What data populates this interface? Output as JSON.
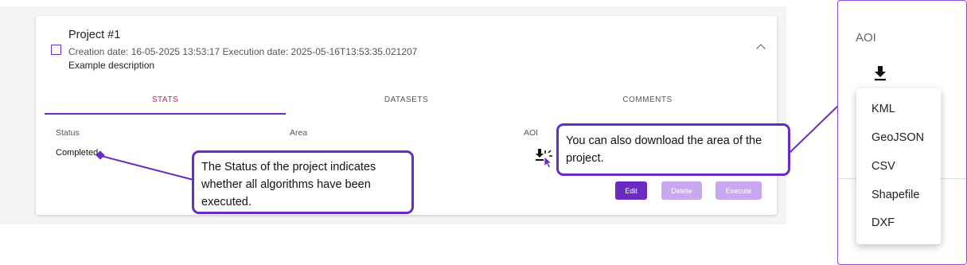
{
  "project": {
    "title": "Project #1",
    "dates": "Creation date: 16-05-2025 13:53:17 Execution date: 2025-05-16T13:53:35.021207",
    "description": "Example description"
  },
  "tabs": {
    "stats": "STATS",
    "datasets": "DATASETS",
    "comments": "COMMENTS"
  },
  "stats": {
    "status_label": "Status",
    "status_value": "Completed",
    "area_label": "Area",
    "aoi_label": "AOI"
  },
  "actions": {
    "edit": "Edit",
    "delete": "Delete",
    "execute": "Execute"
  },
  "callouts": {
    "status": "The Status of the project indicates whether all algorithms have been executed.",
    "aoi": "You can also download the area of the project."
  },
  "aoi_panel": {
    "title": "AOI",
    "download_icon": "download-icon",
    "formats": [
      "KML",
      "GeoJSON",
      "CSV",
      "Shapefile",
      "DXF"
    ]
  },
  "colors": {
    "accent": "#6a2bc2",
    "tab_active": "#d81b60",
    "button_disabled": "#c9a8ef"
  }
}
